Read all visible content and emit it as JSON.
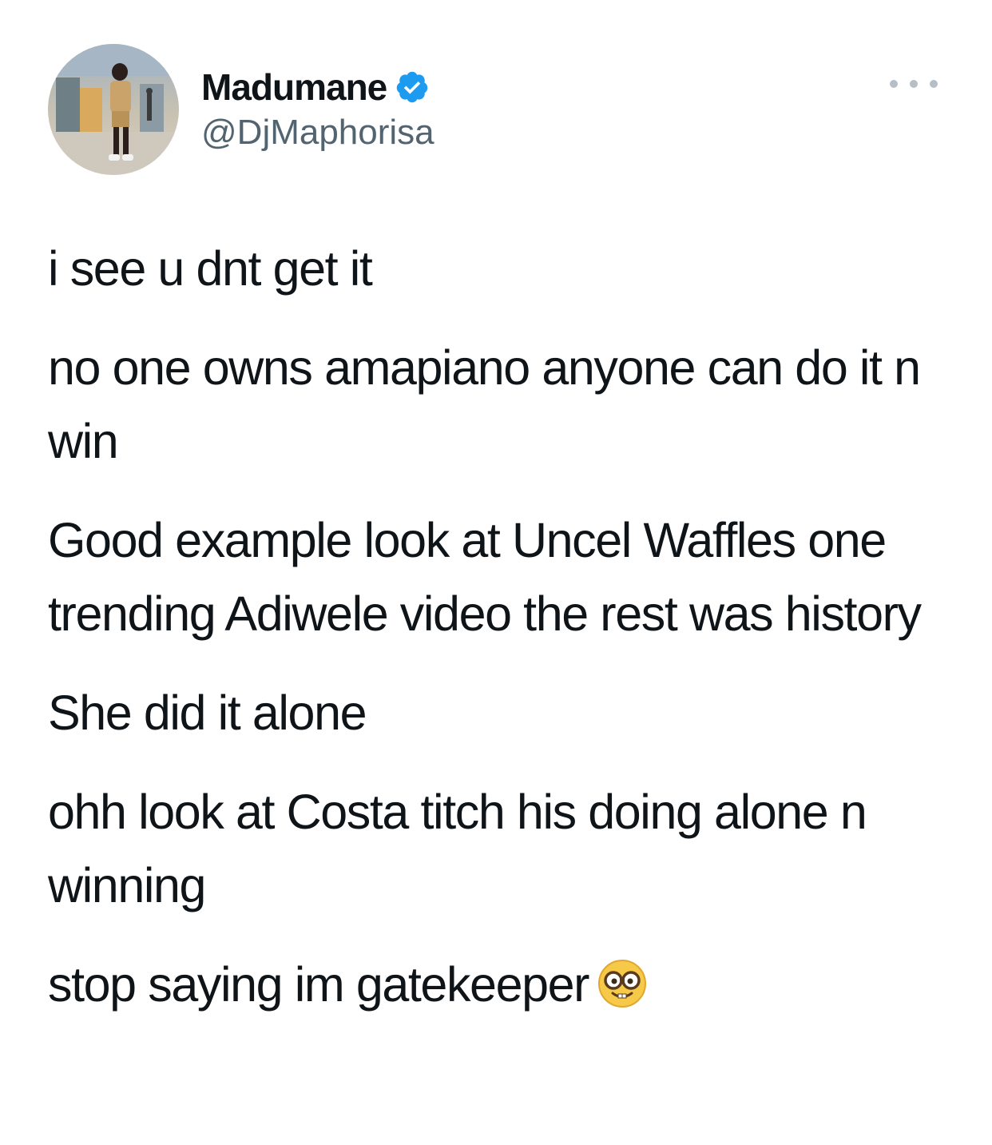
{
  "tweet": {
    "author": {
      "display_name": "Madumane",
      "handle": "@DjMaphorisa",
      "verified": true,
      "verified_color": "#1d9bf0",
      "avatar_icon": "profile-photo-avatar"
    },
    "more_icon": "more-options-icon",
    "paragraphs": [
      "i see u dnt get it",
      "no one owns amapiano anyone can do it n win",
      "Good example look at Uncel Waffles one trending Adiwele video the rest was history",
      "She did it alone",
      "ohh look at Costa titch his doing alone n winning",
      "stop saying im gatekeeper"
    ],
    "trailing_emoji": "nerd-face-emoji"
  }
}
